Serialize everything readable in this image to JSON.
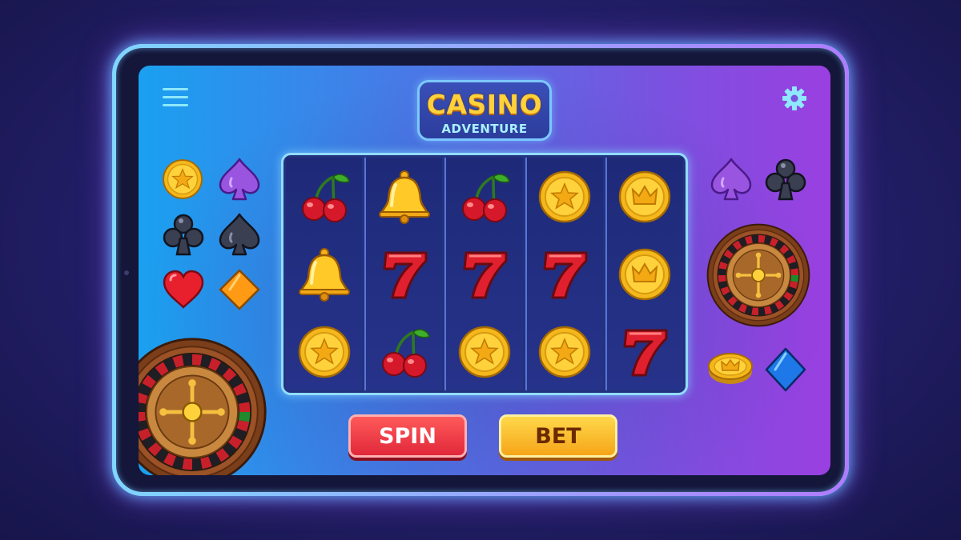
{
  "title": {
    "main": "CASINO",
    "sub": "ADVENTURE"
  },
  "header": {
    "menu_icon": "hamburger-menu-icon",
    "settings_icon": "gear-icon"
  },
  "reels": [
    [
      "cherry",
      "bell",
      "coin-star"
    ],
    [
      "bell",
      "seven",
      "cherry"
    ],
    [
      "cherry",
      "seven",
      "coin-star"
    ],
    [
      "coin-star",
      "seven",
      "coin-star"
    ],
    [
      "coin-crown",
      "coin-crown",
      "seven"
    ]
  ],
  "buttons": {
    "spin_label": "SPIN",
    "bet_label": "BET"
  },
  "left_decor": [
    "coin-star",
    "spade-purple",
    "club-dark",
    "spade-dark",
    "heart-red",
    "diamond-orange",
    "roulette-wheel"
  ],
  "right_decor": [
    "spade-purple",
    "club-dark",
    "roulette-wheel",
    "coin-crown",
    "diamond-blue"
  ],
  "colors": {
    "spin": "#e0283a",
    "bet": "#f5a51a",
    "title": "#ffd23c",
    "frame_glow": "#7fd0ff"
  }
}
